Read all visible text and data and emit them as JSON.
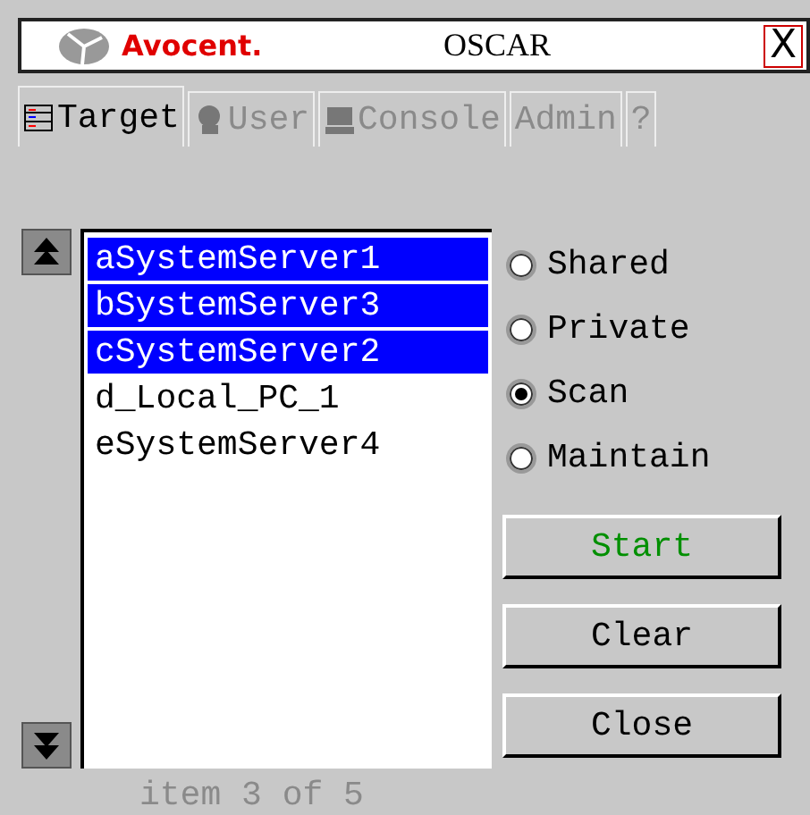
{
  "window": {
    "brand": "Avocent.",
    "title": "OSCAR",
    "close": "X"
  },
  "tabs": [
    {
      "label": "Target",
      "kind": "list",
      "selected": true,
      "disabled": false
    },
    {
      "label": "User",
      "kind": "user",
      "selected": false,
      "disabled": true
    },
    {
      "label": "Console",
      "kind": "monitor",
      "selected": false,
      "disabled": true
    },
    {
      "label": "Admin",
      "kind": "plain",
      "selected": false,
      "disabled": true
    },
    {
      "label": "?",
      "kind": "plain",
      "selected": false,
      "disabled": true
    }
  ],
  "servers": [
    {
      "name": "aSystemServer1",
      "selected": true
    },
    {
      "name": "bSystemServer3",
      "selected": true
    },
    {
      "name": "cSystemServer2",
      "selected": true
    },
    {
      "name": "d_Local_PC_1",
      "selected": false
    },
    {
      "name": "eSystemServer4",
      "selected": false
    }
  ],
  "modes": [
    {
      "label": "Shared",
      "selected": false
    },
    {
      "label": "Private",
      "selected": false
    },
    {
      "label": "Scan",
      "selected": true
    },
    {
      "label": "Maintain",
      "selected": false
    }
  ],
  "buttons": [
    {
      "label": "Start",
      "color": "#008f00"
    },
    {
      "label": "Clear",
      "color": "#000000"
    },
    {
      "label": "Close",
      "color": "#000000"
    }
  ],
  "status": "item 3 of 5"
}
